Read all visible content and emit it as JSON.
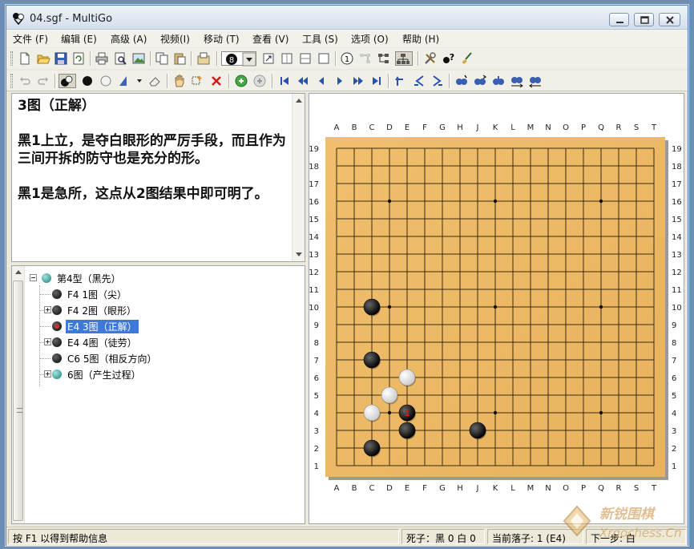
{
  "window": {
    "title": "04.sgf - MultiGo",
    "icon": "multigo-app-icon",
    "controls": [
      "minimize-icon",
      "maximize-icon",
      "close-icon"
    ]
  },
  "menu": [
    {
      "label": "文件 (F)"
    },
    {
      "label": "编辑 (E)"
    },
    {
      "label": "高级 (A)"
    },
    {
      "label": "视频(I)"
    },
    {
      "label": "移动 (T)"
    },
    {
      "label": "查看 (V)"
    },
    {
      "label": "工具 (S)"
    },
    {
      "label": "选项 (O)"
    },
    {
      "label": "帮助 (H)"
    }
  ],
  "toolbar1": {
    "icons": [
      "new-file-icon",
      "open-folder-icon",
      "save-icon",
      "refresh-icon",
      "print-icon",
      "print-preview-icon",
      "image-export-icon",
      "copy-icon",
      "paste-icon",
      "properties-icon",
      "move-number-dropdown-icon",
      "board-view-1-icon",
      "board-view-2-icon",
      "board-view-3-icon",
      "board-view-4-icon",
      "move-number-icon",
      "tree-view-1-icon",
      "tree-view-2-icon",
      "tree-view-3-icon",
      "tools-icon",
      "stone-question-icon",
      "brush-icon"
    ]
  },
  "toolbar2": {
    "icons": [
      "undo-icon",
      "redo-icon",
      "alternate-play-icon",
      "black-stone-icon",
      "white-stone-icon",
      "marker-icon",
      "eraser-icon",
      "hand-icon",
      "select-region-icon",
      "delete-icon",
      "play-start-icon",
      "play-pause-icon",
      "first-move-icon",
      "fast-back-icon",
      "back-icon",
      "forward-icon",
      "fast-forward-icon",
      "last-move-icon",
      "branch-up-icon",
      "branch-prev-icon",
      "branch-next-icon",
      "search-1-icon",
      "search-2-icon",
      "search-3-icon",
      "swap-icon",
      "swap-2-icon"
    ]
  },
  "comment": {
    "paragraphs": [
      "3图（正解）",
      "黑1上立，是夺白眼形的严厉手段，而且作为三间开拆的防守也是充分的形。",
      "黑1是急所，这点从2图结果中即可明了。"
    ]
  },
  "tree": {
    "root": {
      "label": "第4型（黑先）",
      "stone": "teal"
    },
    "children": [
      {
        "label": "F4 1图（尖）",
        "stone": "black",
        "expandable": false
      },
      {
        "label": "F4 2图（眼形）",
        "stone": "black",
        "expandable": true
      },
      {
        "label": "E4 3图（正解）",
        "stone": "black-marked",
        "expandable": false,
        "selected": true
      },
      {
        "label": "E4 4图（徒劳）",
        "stone": "black",
        "expandable": true
      },
      {
        "label": "C6 5图（相反方向）",
        "stone": "black",
        "expandable": false
      },
      {
        "label": "6图（产生过程）",
        "stone": "teal",
        "expandable": true
      }
    ]
  },
  "board": {
    "columns": [
      "A",
      "B",
      "C",
      "D",
      "E",
      "F",
      "G",
      "H",
      "J",
      "K",
      "L",
      "M",
      "N",
      "O",
      "P",
      "Q",
      "R",
      "S",
      "T"
    ],
    "rows": [
      "19",
      "18",
      "17",
      "16",
      "15",
      "14",
      "13",
      "12",
      "11",
      "10",
      "9",
      "8",
      "7",
      "6",
      "5",
      "4",
      "3",
      "2",
      "1"
    ],
    "hoshi": [
      "D16",
      "K16",
      "Q16",
      "D10",
      "K10",
      "Q10",
      "D4",
      "K4",
      "Q4"
    ],
    "stones": [
      {
        "point": "C10",
        "color": "black"
      },
      {
        "point": "C7",
        "color": "black"
      },
      {
        "point": "E6",
        "color": "white"
      },
      {
        "point": "D5",
        "color": "white"
      },
      {
        "point": "C4",
        "color": "white"
      },
      {
        "point": "E4",
        "color": "black",
        "label": "1"
      },
      {
        "point": "E3",
        "color": "black"
      },
      {
        "point": "J3",
        "color": "black"
      },
      {
        "point": "C2",
        "color": "black"
      }
    ],
    "colors": {
      "wood": "#e8b25e",
      "line": "#3a2a10"
    }
  },
  "status": {
    "help": "按 F1 以得到帮助信息",
    "captures": "死子：黑 0 白 0",
    "current": "当前落子: 1 (E4)",
    "next": "下一步: 白"
  }
}
